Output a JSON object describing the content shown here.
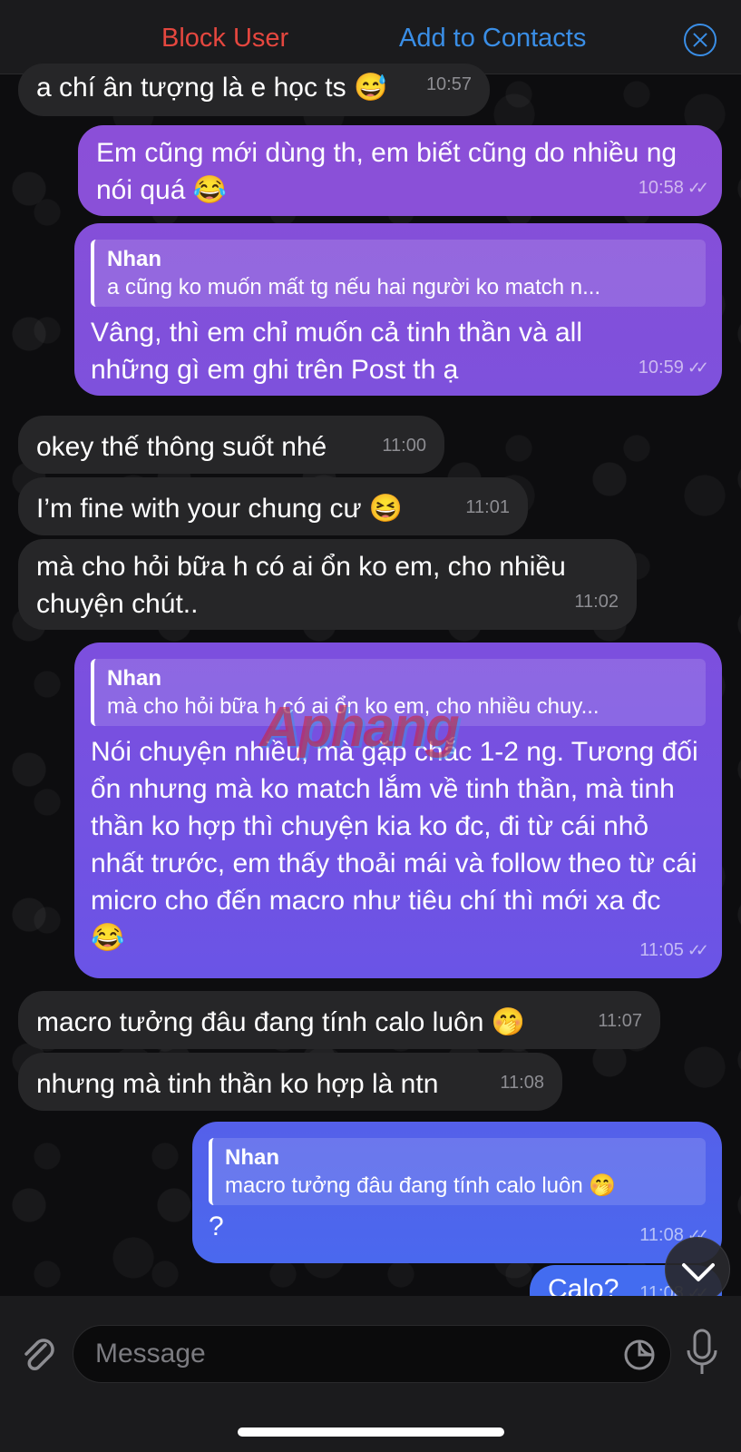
{
  "header": {
    "block_user": "Block User",
    "add_to_contacts": "Add to Contacts"
  },
  "messages": [
    {
      "dir": "in",
      "text": "a chí ân tượng là e học ts 😅",
      "time": "10:57"
    },
    {
      "dir": "out",
      "text": "Em cũng mới dùng th, em biết cũng do nhiều ng nói quá 😂",
      "time": "10:58"
    },
    {
      "dir": "out",
      "reply_name": "Nhan",
      "reply_text": "a cũng ko muốn mất tg nếu hai người ko match n...",
      "text": "Vâng, thì em chỉ muốn cả tinh thần và all những gì em ghi trên Post th ạ",
      "time": "10:59"
    },
    {
      "dir": "in",
      "text": "okey thế thông suốt nhé",
      "time": "11:00"
    },
    {
      "dir": "in",
      "text": "I’m fine with your chung cư 😆",
      "time": "11:01"
    },
    {
      "dir": "in",
      "text": "mà cho hỏi bữa h có ai ổn ko em, cho nhiều chuyện chút..",
      "time": "11:02"
    },
    {
      "dir": "out",
      "reply_name": "Nhan",
      "reply_text": "mà cho hỏi bữa h có ai ổn ko em, cho nhiều chuy...",
      "text": "Nói chuyện nhiều, mà gặp chắc 1-2 ng. Tương đối ổn nhưng mà ko match lắm về tinh thần, mà tinh thần ko hợp thì chuyện kia ko đc, đi từ cái nhỏ nhất trước, em thấy thoải mái và follow theo từ cái micro cho đến macro như tiêu chí thì mới xa đc 😂",
      "time": "11:05"
    },
    {
      "dir": "in",
      "text": "macro tưởng đâu đang tính calo luôn 🤭",
      "time": "11:07"
    },
    {
      "dir": "in",
      "text": "nhưng mà tinh thần ko hợp là ntn",
      "time": "11:08"
    },
    {
      "dir": "out",
      "reply_name": "Nhan",
      "reply_text": "macro tưởng đâu đang tính calo luôn 🤭",
      "text": "?",
      "time": "11:08"
    },
    {
      "dir": "out",
      "text": "Calo?",
      "time": "11:08"
    }
  ],
  "input": {
    "placeholder": "Message"
  },
  "watermark": "Aphang",
  "colors": {
    "block_red": "#e5473f",
    "link_blue": "#3a8ee6",
    "incoming_bubble": "#262628",
    "outgoing_top": "#8a4fd8",
    "outgoing_bottom": "#3d6ef0"
  },
  "icons": {
    "close": "close-icon",
    "attach": "paperclip-icon",
    "sticker": "sticker-icon",
    "mic": "microphone-icon",
    "scroll": "chevron-down-icon"
  }
}
